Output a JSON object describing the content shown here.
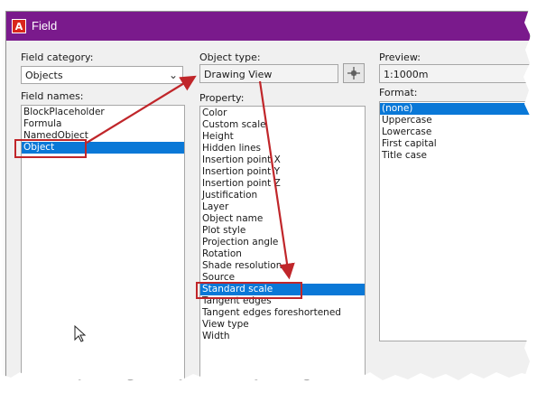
{
  "window": {
    "title": "Field",
    "app_icon_letter": "A"
  },
  "field_category": {
    "label": "Field category:",
    "value": "Objects"
  },
  "field_names": {
    "label": "Field names:",
    "items": [
      "BlockPlaceholder",
      "Formula",
      "NamedObject",
      "Object"
    ],
    "selected_index": 3
  },
  "object_type": {
    "label": "Object type:",
    "value": "Drawing View"
  },
  "property": {
    "label": "Property:",
    "items": [
      "Color",
      "Custom scale",
      "Height",
      "Hidden lines",
      "Insertion point X",
      "Insertion point Y",
      "Insertion point Z",
      "Justification",
      "Layer",
      "Object name",
      "Plot style",
      "Projection angle",
      "Rotation",
      "Shade resolution",
      "Source",
      "Standard scale",
      "Tangent edges",
      "Tangent edges foreshortened",
      "View type",
      "Width"
    ],
    "selected_index": 15
  },
  "preview": {
    "label": "Preview:",
    "value": "1:1000m"
  },
  "format": {
    "label": "Format:",
    "items": [
      "(none)",
      "Uppercase",
      "Lowercase",
      "First capital",
      "Title case"
    ],
    "selected_index": 0
  },
  "colors": {
    "title_bar": "#7a1a8c",
    "selection": "#0a78d7",
    "annotation": "#c0262a"
  },
  "icons": [
    "autocad-app-icon",
    "chevron-down-icon",
    "crosshair-icon",
    "mouse-pointer-icon"
  ]
}
